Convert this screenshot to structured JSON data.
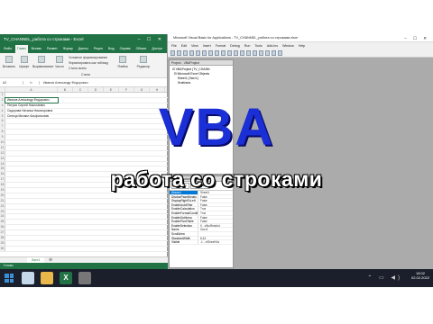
{
  "excel": {
    "title": "TV_CHANNEL_работа со строками - Excel",
    "window_controls": "– ☐ ✕",
    "tabs": [
      "Файл",
      "Главн",
      "Вставк",
      "Размет",
      "Форму",
      "Данны",
      "Рецен",
      "Вид",
      "Справк",
      "Обшие",
      "Доступ"
    ],
    "ribbon": {
      "paste": "Вставить",
      "font": "Шрифт",
      "align": "Выравнивание",
      "number": "Число",
      "cond_format": "Условное форматирование",
      "as_table": "Форматировать как таблицу",
      "cell_styles": "Стили ячеек",
      "cells": "Ячейки",
      "edit": "Редактир",
      "styles": "Стили"
    },
    "namebox": "A2",
    "fx": "fx",
    "formula": "Иванов Александр Федорович",
    "columns": [
      "A",
      "B",
      "C",
      "D",
      "E",
      "F",
      "G",
      "H"
    ],
    "rows": [
      {
        "n": "1",
        "v": ""
      },
      {
        "n": "2",
        "v": "Иванов Александр Федорович"
      },
      {
        "n": "3",
        "v": "Петров Сергей Николаевич"
      },
      {
        "n": "4",
        "v": "Сидорова Наталья Никоноровна"
      },
      {
        "n": "5",
        "v": "Сенеца Михаил Альфонсович"
      },
      {
        "n": "6",
        "v": ""
      },
      {
        "n": "7",
        "v": ""
      },
      {
        "n": "8",
        "v": ""
      },
      {
        "n": "9",
        "v": ""
      },
      {
        "n": "10",
        "v": ""
      },
      {
        "n": "11",
        "v": ""
      },
      {
        "n": "12",
        "v": ""
      },
      {
        "n": "13",
        "v": ""
      },
      {
        "n": "14",
        "v": ""
      },
      {
        "n": "15",
        "v": ""
      },
      {
        "n": "16",
        "v": ""
      },
      {
        "n": "17",
        "v": ""
      },
      {
        "n": "18",
        "v": ""
      },
      {
        "n": "19",
        "v": ""
      },
      {
        "n": "20",
        "v": ""
      },
      {
        "n": "21",
        "v": ""
      },
      {
        "n": "22",
        "v": ""
      },
      {
        "n": "23",
        "v": ""
      },
      {
        "n": "24",
        "v": ""
      },
      {
        "n": "25",
        "v": ""
      },
      {
        "n": "26",
        "v": ""
      },
      {
        "n": "27",
        "v": ""
      },
      {
        "n": "28",
        "v": ""
      },
      {
        "n": "29",
        "v": ""
      },
      {
        "n": "30",
        "v": ""
      }
    ],
    "sheet_tab": "Лист1",
    "add_sheet": "⊕",
    "status": "Готово"
  },
  "vba": {
    "title": "Microsoft Visual Basic for Applications - TV_CHANNEL_работа со строками.xlsm",
    "window_controls": "– ☐ ✕",
    "menu": [
      "File",
      "Edit",
      "View",
      "Insert",
      "Format",
      "Debug",
      "Run",
      "Tools",
      "Add-Ins",
      "Window",
      "Help"
    ],
    "project_header": "Project - VBAProject",
    "tree": [
      "⊟ VBAProject (TV_CHANN",
      "  ⊟ Microsoft Excel Objects",
      "      Sheet1 (Лист1)",
      "      ЭтаКнига"
    ],
    "props_header": "Лист1 Worksheet",
    "prop_tabs": [
      "Alphabetic",
      "Categorized"
    ],
    "props": [
      {
        "k": "(Name)",
        "v": "Sheet1"
      },
      {
        "k": "DisplayPageBreaks",
        "v": "False"
      },
      {
        "k": "DisplayRightToLeft",
        "v": "False"
      },
      {
        "k": "EnableAutoFilter",
        "v": "False"
      },
      {
        "k": "EnableCalculation",
        "v": "True"
      },
      {
        "k": "EnableFormatConditi",
        "v": "True"
      },
      {
        "k": "EnableOutlining",
        "v": "False"
      },
      {
        "k": "EnablePivotTable",
        "v": "False"
      },
      {
        "k": "EnableSelection",
        "v": "0 - xlNoRestrict"
      },
      {
        "k": "Name",
        "v": "Лист1"
      },
      {
        "k": "ScrollArea",
        "v": ""
      },
      {
        "k": "StandardWidth",
        "v": "8,43"
      },
      {
        "k": "Visible",
        "v": "-1 - xlSheetVisi"
      }
    ]
  },
  "overlay": {
    "title": "VBA",
    "subtitle": "работа со строками"
  },
  "taskbar": {
    "excel_letter": "X",
    "time": "18:02",
    "date": "02.02.2022",
    "tray_icons": "⌃ ▭ ◀)"
  }
}
